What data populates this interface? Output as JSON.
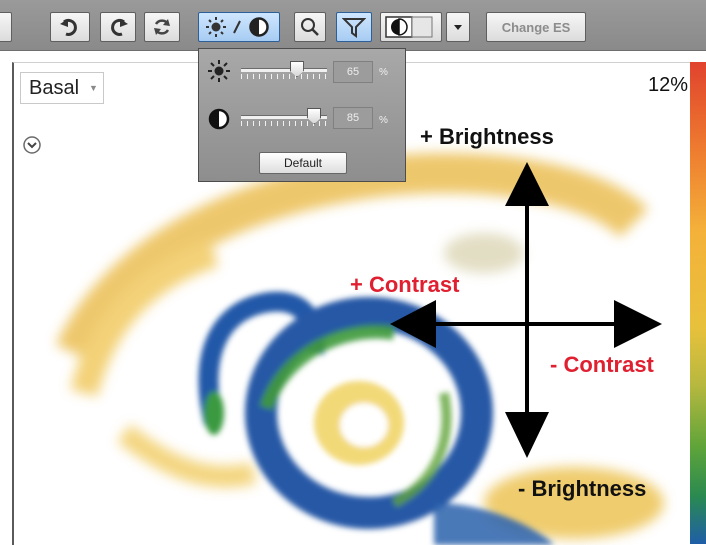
{
  "toolbar": {
    "change_es_label": "Change ES"
  },
  "viewer": {
    "slice_selector_value": "Basal",
    "percent_readout": "12%"
  },
  "popup": {
    "brightness": {
      "value": "65",
      "unit": "%",
      "level": 0.65
    },
    "contrast": {
      "value": "85",
      "unit": "%",
      "level": 0.85
    },
    "default_label": "Default"
  },
  "annotations": {
    "plus_brightness": "+ Brightness",
    "minus_brightness": "- Brightness",
    "plus_contrast": "+ Contrast",
    "minus_contrast": "- Contrast"
  },
  "colors": {
    "annotation_red": "#e02030",
    "colorbar": [
      "#e0432e",
      "#ee7b2f",
      "#f4b13a",
      "#e8c13c",
      "#5ea43a",
      "#2a8a50",
      "#1f5ea8"
    ]
  },
  "icons": [
    "undo-icon",
    "redo-icon",
    "reset-icon",
    "brightness-contrast-icon",
    "zoom-icon",
    "filter-icon",
    "colormap-icon",
    "chevron-down-icon",
    "sun-icon",
    "contrast-icon"
  ]
}
